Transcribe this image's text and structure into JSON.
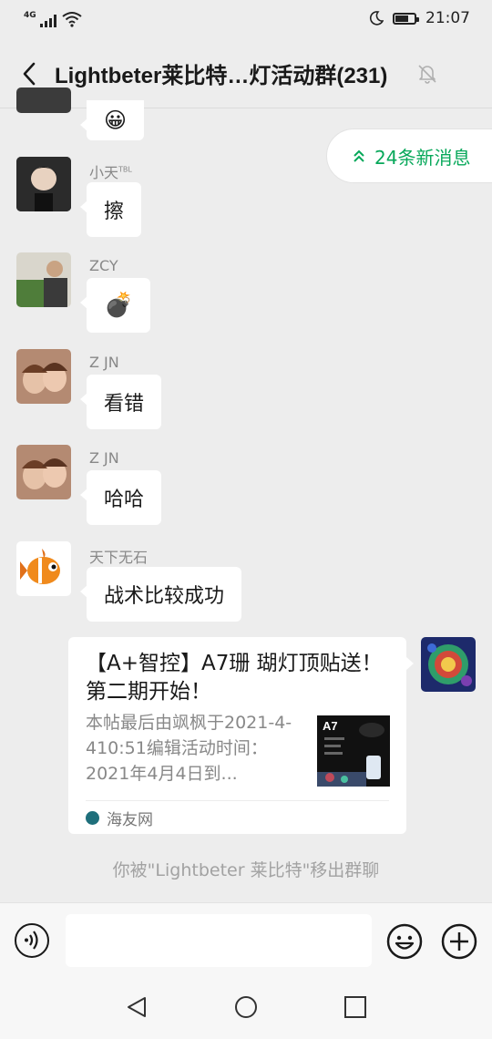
{
  "status_bar": {
    "network": "4G",
    "time": "21:07",
    "battery_level": 0.7
  },
  "header": {
    "title": "Lightbeter莱比特…灯活动群(231)"
  },
  "new_messages_pill": {
    "label": "24条新消息"
  },
  "messages": [
    {
      "sender": "小天",
      "sender_badge": "TBL",
      "text": "擦"
    },
    {
      "sender": "ZCY",
      "text": "💣"
    },
    {
      "sender": "Z JN",
      "text": "看错"
    },
    {
      "sender": "Z JN",
      "text": "哈哈"
    },
    {
      "sender": "天下无石",
      "text": "战术比较成功"
    }
  ],
  "partial_top_message": {
    "text": "😀"
  },
  "link_card": {
    "title": "【A+智控】A7珊 瑚灯顶贴送！ 第二期开始！",
    "description": "本帖最后由飒枫于2021-4-410:51编辑活动时间：2021年4月4日到...",
    "thumbnail_text": "A7",
    "source": "海友网"
  },
  "system_notice": "你被\"Lightbeter 莱比特\"移出群聊",
  "colors": {
    "accent_green": "#07a85a",
    "background": "#ededed"
  }
}
